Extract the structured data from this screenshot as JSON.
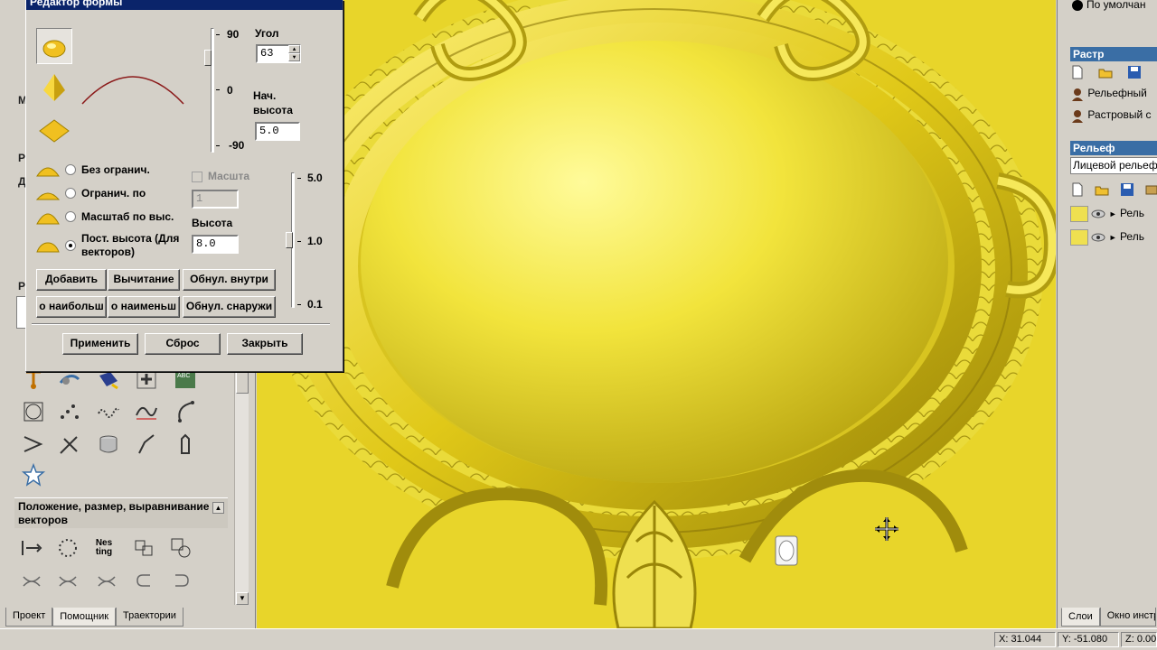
{
  "left_panel": {
    "fragments": [
      "М",
      "Р",
      "Д",
      "Р"
    ],
    "section_header": "Положение, размер, выравнивание векторов",
    "tabs": [
      "Проект",
      "Помощник",
      "Траектории"
    ],
    "tools_row1": [
      "move-node-icon",
      "paint-icon",
      "bucket-icon",
      "add-icon",
      "text-icon"
    ],
    "tools_row2": [
      "grid-icon",
      "dots-icon",
      "wave-icon",
      "curve-icon",
      "arc-icon"
    ],
    "tools_row3": [
      "arrow-icon",
      "cut-icon",
      "cylinder-icon",
      "bend-icon",
      "hand-icon"
    ],
    "tools_row4": [
      "star-icon"
    ],
    "pos_tools": [
      "align-left-icon",
      "circle-dots-icon",
      "nesting-icon",
      "array-icon",
      "shape-combine-icon"
    ],
    "nesting_label": "Nes ting"
  },
  "dialog": {
    "title": "Редактор формы",
    "angle_label": "Угол",
    "angle_value": "63",
    "start_height_label": "Нач. высота",
    "start_height_value": "5.0",
    "slider1_ticks": [
      "90",
      "0",
      "-90"
    ],
    "slider2_ticks": [
      "5.0",
      "1.0",
      "0.1"
    ],
    "options": [
      {
        "label": "Без огранич.",
        "checked": false
      },
      {
        "label": "Огранич. по",
        "checked": false
      },
      {
        "label": "Масштаб по выс.",
        "checked": false
      },
      {
        "label": "Пост. высота (Для векторов)",
        "checked": true
      }
    ],
    "scale_label": "Масшта",
    "scale_value": "1",
    "height_label": "Высота",
    "height_value": "8.0",
    "buttons_row1": [
      "Добавить",
      "Вычитание",
      "Обнул. внутри"
    ],
    "buttons_row2": [
      "о наибольш",
      "о наименьш",
      "Обнул. снаружи"
    ],
    "apply": "Применить",
    "reset": "Сброс",
    "close": "Закрыть"
  },
  "right_panel": {
    "top_item": "По умолчан",
    "raster_header": "Растр",
    "raster_layers": [
      "Рельефный",
      "Растровый с"
    ],
    "relief_header": "Рельеф",
    "relief_input": "Лицевой рельеф",
    "relief_layers": [
      "Рель",
      "Рель"
    ],
    "tabs": [
      "Слои",
      "Окно инстр"
    ]
  },
  "status": {
    "x": "X: 31.044",
    "y": "Y: -51.080",
    "z": "Z: 0.00"
  },
  "colors": {
    "relief": "#e8d52a",
    "dialog_bg": "#d4d0c8",
    "panel_header": "#3a6ea5"
  }
}
